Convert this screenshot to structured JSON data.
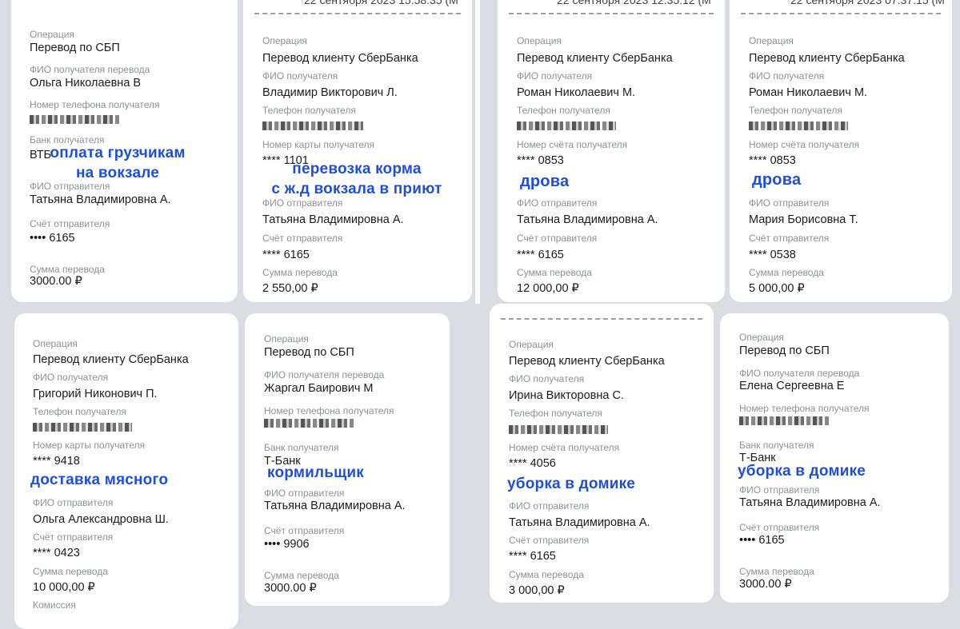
{
  "receipts": [
    {
      "date": "",
      "op_label": "Операция",
      "op_value": "Перевод по СБП",
      "f1_label": "ФИО получателя перевода",
      "f1_value": "Ольга Николаевна В",
      "f2_label": "Номер телефона получателя",
      "f3_label": "Банк получателя",
      "f3_value": "ВТБ",
      "note": "оплата грузчикам\nна вокзале",
      "sender_label": "ФИО отправителя",
      "sender_value": "Татьяна Владимировна А.",
      "acc_label": "Счёт отправителя",
      "acc_value": "•••• 6165",
      "sum_label": "Сумма перевода",
      "sum_value": "3000.00 ₽"
    },
    {
      "date": "22 сентября 2023 15:58:35 (М",
      "op_label": "Операция",
      "op_value": "Перевод клиенту СберБанка",
      "f1_label": "ФИО получателя",
      "f1_value": "Владимир Викторович Л.",
      "f2_label": "Телефон получателя",
      "f3_label": "Номер карты получателя",
      "f3_value": "**** 1101",
      "note": "перевозка корма\nс ж.д вокзала в приют",
      "sender_label": "ФИО отправителя",
      "sender_value": "Татьяна Владимировна А.",
      "acc_label": "Счёт отправителя",
      "acc_value": "**** 6165",
      "sum_label": "Сумма перевода",
      "sum_value": "2 550,00 ₽"
    },
    {
      "date": "22 сентября 2023 12:35:12 (М",
      "op_label": "Операция",
      "op_value": "Перевод клиенту СберБанка",
      "f1_label": "ФИО получателя",
      "f1_value": "Роман Николаевич М.",
      "f2_label": "Телефон получателя",
      "f3_label": "Номер счёта получателя",
      "f3_value": "**** 0853",
      "note": "дрова",
      "sender_label": "ФИО отправителя",
      "sender_value": "Татьяна Владимировна А.",
      "acc_label": "Счёт отправителя",
      "acc_value": "**** 6165",
      "sum_label": "Сумма перевода",
      "sum_value": "12 000,00 ₽"
    },
    {
      "date": "22 сентября 2023 07:37:15 (М",
      "op_label": "Операция",
      "op_value": "Перевод клиенту СберБанка",
      "f1_label": "ФИО получателя",
      "f1_value": "Роман Николаевич М.",
      "f2_label": "Телефон получателя",
      "f3_label": "Номер счёта получателя",
      "f3_value": "**** 0853",
      "note": "дрова",
      "sender_label": "ФИО отправителя",
      "sender_value": "Мария Борисовна Т.",
      "acc_label": "Счёт отправителя",
      "acc_value": "**** 0538",
      "sum_label": "Сумма перевода",
      "sum_value": "5 000,00 ₽"
    },
    {
      "date": "",
      "op_label": "Операция",
      "op_value": "Перевод клиенту СберБанка",
      "f1_label": "ФИО получателя",
      "f1_value": "Григорий Никонович П.",
      "f2_label": "Телефон получателя",
      "f3_label": "Номер карты получателя",
      "f3_value": "**** 9418",
      "note": "доставка мясного",
      "sender_label": "ФИО отправителя",
      "sender_value": "Ольга Александровна Ш.",
      "acc_label": "Счёт отправителя",
      "acc_value": "**** 0423",
      "sum_label": "Сумма перевода",
      "sum_value": "10 000,00 ₽",
      "extra_label": "Комиссия"
    },
    {
      "date": "",
      "op_label": "Операция",
      "op_value": "Перевод по СБП",
      "f1_label": "ФИО получателя перевода",
      "f1_value": "Жаргал Баирович М",
      "f2_label": "Номер телефона получателя",
      "f3_label": "Банк получателя",
      "f3_value": "Т-Банк",
      "note": "кормильщик",
      "sender_label": "ФИО отправителя",
      "sender_value": "Татьяна Владимировна А.",
      "acc_label": "Счёт отправителя",
      "acc_value": "•••• 9906",
      "sum_label": "Сумма перевода",
      "sum_value": "3000.00 ₽"
    },
    {
      "date": "",
      "op_label": "Операция",
      "op_value": "Перевод клиенту СберБанка",
      "f1_label": "ФИО получателя",
      "f1_value": "Ирина Викторовна С.",
      "f2_label": "Телефон получателя",
      "f3_label": "Номер счёта получателя",
      "f3_value": "**** 4056",
      "note": "уборка в домике",
      "sender_label": "ФИО отправителя",
      "sender_value": "Татьяна Владимировна А.",
      "acc_label": "Счёт отправителя",
      "acc_value": "**** 6165",
      "sum_label": "Сумма перевода",
      "sum_value": "3 000,00 ₽"
    },
    {
      "date": "",
      "op_label": "Операция",
      "op_value": "Перевод по СБП",
      "f1_label": "ФИО получателя перевода",
      "f1_value": "Елена Сергеевна Е",
      "f2_label": "Номер телефона получателя",
      "f3_label": "Банк получателя",
      "f3_value": "Т-Банк",
      "note": "уборка в домике",
      "sender_label": "ФИО отправителя",
      "sender_value": "Татьяна Владимировна А.",
      "acc_label": "Счёт отправителя",
      "acc_value": "•••• 6165",
      "sum_label": "Сумма перевода",
      "sum_value": "3000.00 ₽"
    }
  ],
  "colors": {
    "annotation": "#1f4fd6",
    "label": "#8d9096",
    "background": "#dcdde2"
  }
}
